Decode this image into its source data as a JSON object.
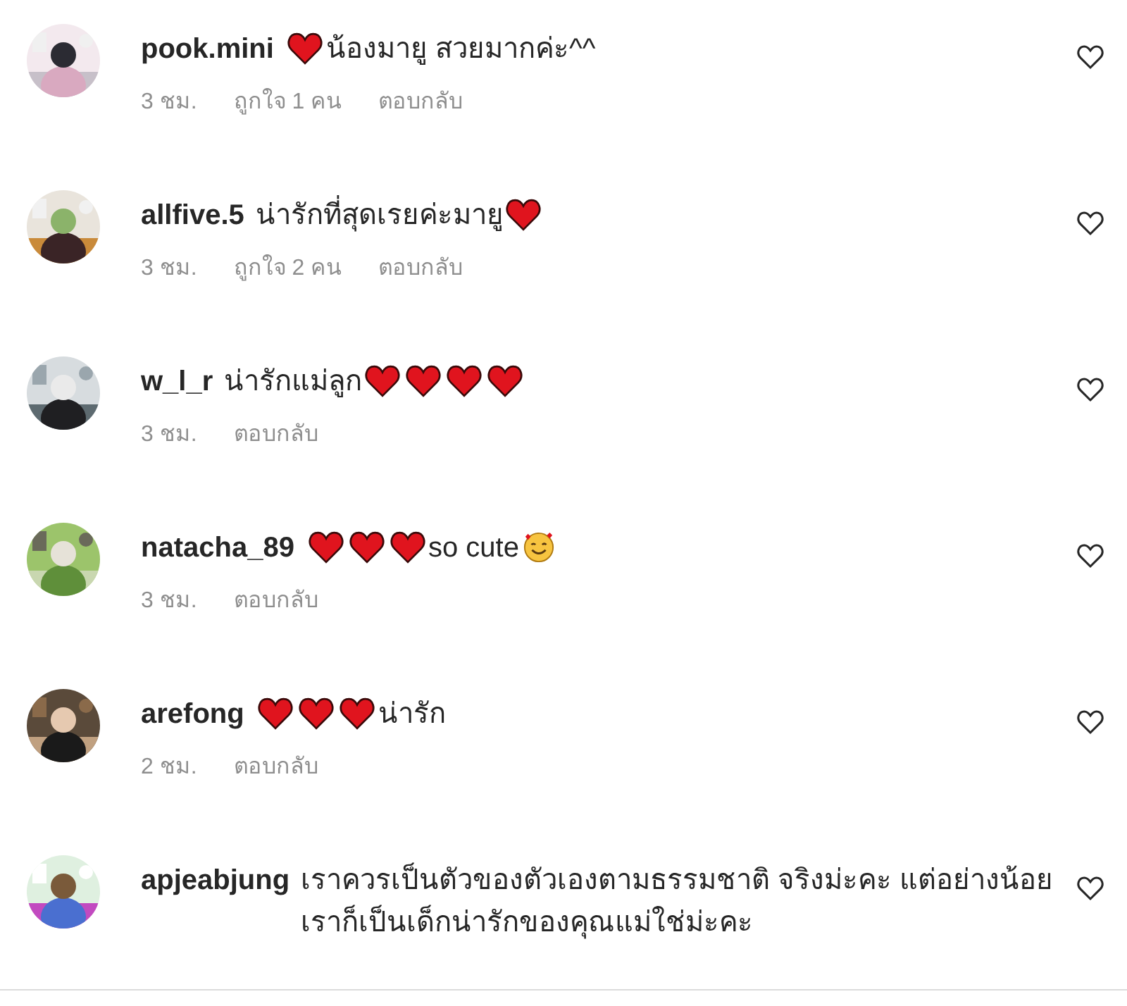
{
  "comments": [
    {
      "username": "pook.mini",
      "avatar": {
        "kind": "picture"
      },
      "parts": [
        {
          "kind": "heart"
        },
        {
          "kind": "text",
          "text": "น้องมายู สวยมากค่ะ^^"
        }
      ],
      "meta": {
        "time": "3 ชม.",
        "likes": "ถูกใจ 1 คน",
        "reply": "ตอบกลับ"
      }
    },
    {
      "username": "allfive.5",
      "avatar": {
        "kind": "picture"
      },
      "parts": [
        {
          "kind": "text",
          "text": "น่ารักที่สุดเรยค่ะมายู"
        },
        {
          "kind": "heart"
        }
      ],
      "meta": {
        "time": "3 ชม.",
        "likes": "ถูกใจ 2 คน",
        "reply": "ตอบกลับ"
      }
    },
    {
      "username": "w_l_r",
      "avatar": {
        "kind": "picture"
      },
      "parts": [
        {
          "kind": "text",
          "text": "น่ารักแม่ลูก"
        },
        {
          "kind": "heart"
        },
        {
          "kind": "heart"
        },
        {
          "kind": "heart"
        },
        {
          "kind": "heart"
        }
      ],
      "meta": {
        "time": "3 ชม.",
        "reply": "ตอบกลับ"
      }
    },
    {
      "username": "natacha_89",
      "avatar": {
        "kind": "picture"
      },
      "parts": [
        {
          "kind": "heart"
        },
        {
          "kind": "heart"
        },
        {
          "kind": "heart"
        },
        {
          "kind": "text",
          "text": "so cute"
        },
        {
          "kind": "smile"
        }
      ],
      "meta": {
        "time": "3 ชม.",
        "reply": "ตอบกลับ"
      }
    },
    {
      "username": "arefong",
      "avatar": {
        "kind": "picture"
      },
      "parts": [
        {
          "kind": "heart"
        },
        {
          "kind": "heart"
        },
        {
          "kind": "heart"
        },
        {
          "kind": "text",
          "text": "น่ารัก"
        }
      ],
      "meta": {
        "time": "2 ชม.",
        "reply": "ตอบกลับ"
      }
    },
    {
      "username": "apjeabjung",
      "avatar": {
        "kind": "picture"
      },
      "parts": [
        {
          "kind": "text",
          "text": "เราควรเป็นตัวของตัวเองตามธรรมชาติ จริงม่ะคะ แต่อย่างน้อยเราก็เป็นเด็กน่ารักของคุณแม่ใช่ม่ะคะ"
        }
      ]
    }
  ]
}
